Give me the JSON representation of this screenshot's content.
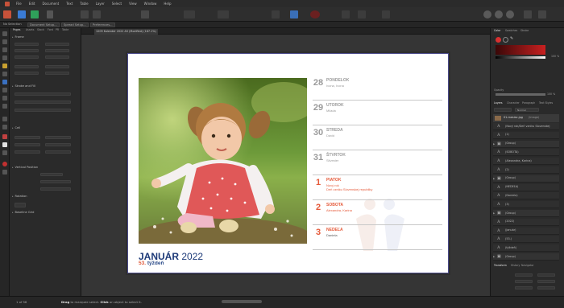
{
  "menu": [
    "File",
    "Edit",
    "Document",
    "Text",
    "Table",
    "Layer",
    "Select",
    "View",
    "Window",
    "Help"
  ],
  "context": {
    "no_selection": "No Selection",
    "document_setup": "Document Setup...",
    "spread_setup": "Spread Setup...",
    "preferences": "Preferences..."
  },
  "left_tabs": [
    "Pages",
    "Assets",
    "Stock",
    "Font",
    "PR",
    "Table"
  ],
  "left_sections": [
    "Frame",
    "Stroke and Fill",
    "Cell",
    "Vertical Position",
    "Rotation",
    "Baseline Grid"
  ],
  "doc_tab": "1209 Kalendár 2022 A5 (Modified) (187.1%)",
  "calendar": {
    "month": "JANUÁR",
    "year": "2022",
    "week_num": "53.",
    "week_word": "týždeň",
    "days": [
      {
        "num": "28",
        "name": "PONDELOK",
        "note": "Ivona, Ivona",
        "style": "gray"
      },
      {
        "num": "29",
        "name": "UTOROK",
        "note": "Milada",
        "style": "gray"
      },
      {
        "num": "30",
        "name": "STREDA",
        "note": "Dávid",
        "style": "gray"
      },
      {
        "num": "31",
        "name": "ŠTVRTOK",
        "note": "Silvester",
        "style": "gray"
      },
      {
        "num": "1",
        "name": "PIATOK",
        "note": "Nový rok\nDeň vzniku Slovenskej republiky",
        "style": "red"
      },
      {
        "num": "2",
        "name": "SOBOTA",
        "note": "Alexandra, Karina",
        "style": "red"
      },
      {
        "num": "3",
        "name": "NEDEĽA",
        "note": "Daniela",
        "style": "red sun"
      }
    ]
  },
  "right": {
    "tabs_top": [
      "Color",
      "Swatches",
      "Stroke"
    ],
    "opacity_label": "Opacity",
    "opacity_value": "100 %",
    "tabs_layers": [
      "Layers",
      "Character",
      "Paragraph",
      "Text Styles"
    ],
    "blend_mode": "Normal",
    "image_layer": "01-mesiac.jpg",
    "image_layer_kind": "(Image)",
    "layers": [
      {
        "name": "(Nový rok/Deň vzniku Slovenskej",
        "kind": "text",
        "group": false
      },
      {
        "name": "(1)",
        "kind": "text",
        "group": false
      },
      {
        "name": "(Group)",
        "kind": "group",
        "group": true
      },
      {
        "name": "(SOBOTA)",
        "kind": "text",
        "group": false
      },
      {
        "name": "(Alexandra, Karina)",
        "kind": "text",
        "group": false
      },
      {
        "name": "(2)",
        "kind": "text",
        "group": false
      },
      {
        "name": "(Group)",
        "kind": "group",
        "group": true
      },
      {
        "name": "(NEDEĽA)",
        "kind": "text",
        "group": false
      },
      {
        "name": "(Daniela)",
        "kind": "text",
        "group": false
      },
      {
        "name": "(3)",
        "kind": "text",
        "group": false
      },
      {
        "name": "(Group)",
        "kind": "group",
        "group": true
      },
      {
        "name": "(2022)",
        "kind": "text",
        "group": false
      },
      {
        "name": "(Január)",
        "kind": "text",
        "group": false
      },
      {
        "name": "(53.)",
        "kind": "text",
        "group": false
      },
      {
        "name": "(týždeň)",
        "kind": "text",
        "group": false
      },
      {
        "name": "(Group)",
        "kind": "group",
        "group": true
      }
    ],
    "bottom_tabs": [
      "Transform",
      "History",
      "Navigator"
    ]
  },
  "status": {
    "page": "1 of 56",
    "drag": "Drag",
    "drag_text": "to marquee select.",
    "click": "Click",
    "click_text": "an object to select it."
  }
}
